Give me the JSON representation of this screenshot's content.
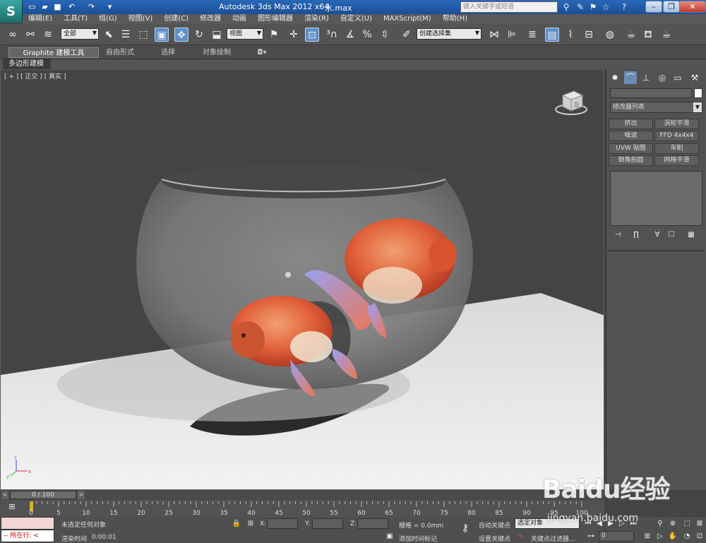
{
  "title_bar": {
    "app_title": "Autodesk 3ds Max  2012 x64",
    "file_name": "水.max",
    "search_placeholder": "键入关键字或短语"
  },
  "menu": {
    "items": [
      "编辑(E)",
      "工具(T)",
      "组(G)",
      "视图(V)",
      "创建(C)",
      "修改器",
      "动画",
      "图形编辑器",
      "渲染(R)",
      "自定义(U)",
      "MAXScript(M)",
      "帮助(H)"
    ]
  },
  "main_toolbar": {
    "selection_filter": "全部",
    "coord_system": "视图",
    "named_selection": "创建选择集"
  },
  "ribbon": {
    "tabs": [
      "Graphite 建模工具",
      "自由形式",
      "选择",
      "对象绘制"
    ],
    "panel_label": "多边形建模"
  },
  "viewport": {
    "label": "[ + ] [ 正交 ] [ 真实 ]",
    "viewcube_face": "左"
  },
  "command_panel": {
    "modifier_list": "修改器列表",
    "modifier_buttons": [
      "挤出",
      "涡轮平滑",
      "噪波",
      "FFD 4x4x4",
      "UVW 贴图",
      "车削",
      "倒角剖面",
      "网格平滑"
    ]
  },
  "timeline": {
    "slider_text": "0 / 100",
    "ticks": [
      "0",
      "5",
      "10",
      "15",
      "20",
      "25",
      "30",
      "35",
      "40",
      "45",
      "50",
      "55",
      "60",
      "65",
      "70",
      "75",
      "80",
      "85",
      "90",
      "95",
      "100"
    ]
  },
  "status_bar": {
    "maxscript_label": "所在行:",
    "selection_status": "未选定任何对象",
    "render_time_label": "渲染时间",
    "render_time": "0:00:01",
    "x_label": "X:",
    "y_label": "Y:",
    "z_label": "Z:",
    "grid": "栅格 = 0.0mm",
    "add_time_tag": "添加时间标记",
    "auto_key": "自动关键点",
    "set_key": "设置关键点",
    "selected_set": "选定对象",
    "key_filters": "关键点过滤器...",
    "frame": "0"
  },
  "watermark": {
    "logo": "Baidu经验",
    "url": "jingyan.baidu.com"
  }
}
